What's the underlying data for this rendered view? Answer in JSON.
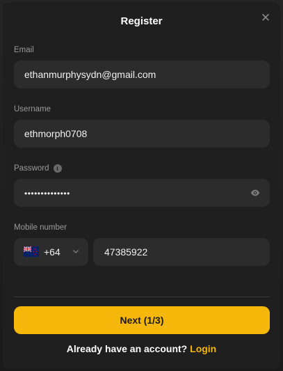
{
  "modal": {
    "title": "Register",
    "close_icon": "close-icon"
  },
  "form": {
    "email_label": "Email",
    "email_value": "ethanmurphysydn@gmail.com",
    "username_label": "Username",
    "username_value": "ethmorph0708",
    "password_label": "Password",
    "password_info_icon": "info-icon",
    "password_masked": "••••••••••••••",
    "password_toggle_icon": "eye-icon",
    "mobile_label": "Mobile number",
    "country_flag_icon": "nz-flag-icon",
    "country_code": "+64",
    "phone_value": "47385922"
  },
  "actions": {
    "next_label": "Next (1/3)",
    "footer_text": "Already have an account?",
    "login_label": "Login"
  },
  "colors": {
    "accent": "#f5b70a",
    "field_bg": "#2c2c2c",
    "modal_bg": "#1f1f1f"
  }
}
